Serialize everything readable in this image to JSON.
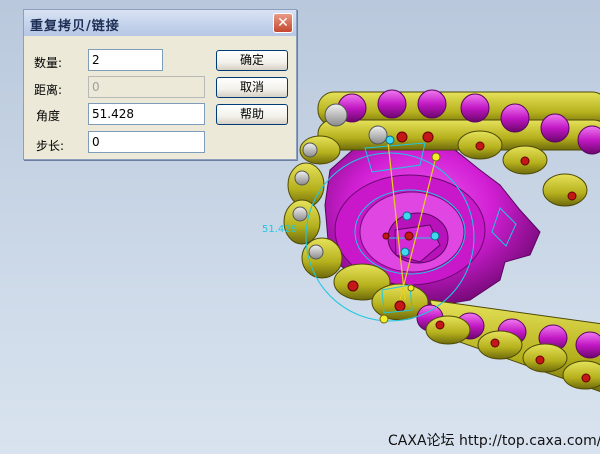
{
  "dialog": {
    "title": "重复拷贝/链接",
    "close_symbol": "✕",
    "fields": {
      "count_label": "数量:",
      "count_value": "2",
      "distance_label": "距离:",
      "distance_value": "0",
      "angle_label": "角度",
      "angle_value": "51.428",
      "step_label": "步长:",
      "step_value": "0"
    },
    "buttons": {
      "ok": "确定",
      "cancel": "取消",
      "help": "帮助"
    }
  },
  "viewport": {
    "measure_label": "51.428",
    "colors": {
      "sprocket": "#d21fd6",
      "chain_plate": "#b9b41e",
      "roller": "#c61ec6",
      "pin": "#c41818",
      "construction": "#22c6e0",
      "axis_line": "#e8d020"
    }
  },
  "watermark": "CAXA论坛 http://top.caxa.com/"
}
